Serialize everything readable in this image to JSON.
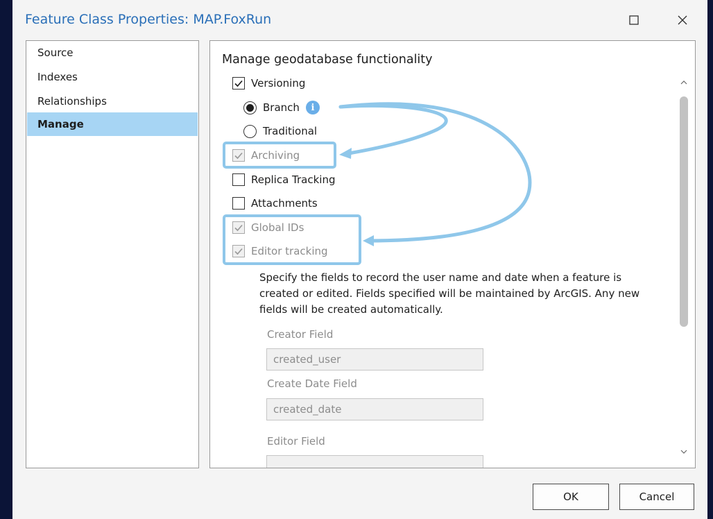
{
  "window": {
    "title": "Feature Class Properties: MAP.FoxRun",
    "maximize_icon": "maximize-icon",
    "close_icon": "close-icon"
  },
  "nav": {
    "items": [
      {
        "label": "Source",
        "active": false
      },
      {
        "label": "Indexes",
        "active": false
      },
      {
        "label": "Relationships",
        "active": false
      },
      {
        "label": "Manage",
        "active": true
      }
    ]
  },
  "manage": {
    "heading": "Manage geodatabase functionality",
    "versioning": {
      "label": "Versioning",
      "checked": true,
      "enabled": true
    },
    "branch": {
      "label": "Branch",
      "selected": true
    },
    "traditional": {
      "label": "Traditional",
      "selected": false
    },
    "archiving": {
      "label": "Archiving",
      "checked": true,
      "enabled": false
    },
    "replica_tracking": {
      "label": "Replica Tracking",
      "checked": false,
      "enabled": true
    },
    "attachments": {
      "label": "Attachments",
      "checked": false,
      "enabled": true
    },
    "global_ids": {
      "label": "Global IDs",
      "checked": true,
      "enabled": false
    },
    "editor_tracking": {
      "label": "Editor tracking",
      "checked": true,
      "enabled": false
    },
    "description": "Specify the fields to record the user name and date when a feature is created or edited. Fields specified will be maintained by ArcGIS. Any new fields will be created automatically.",
    "creator_field": {
      "label": "Creator Field",
      "value": "created_user"
    },
    "create_date_field": {
      "label": "Create Date Field",
      "value": "created_date"
    },
    "editor_field": {
      "label": "Editor Field",
      "value": ""
    }
  },
  "buttons": {
    "ok": "OK",
    "cancel": "Cancel"
  },
  "colors": {
    "title": "#2a6fb8",
    "nav_active": "#a7d5f4",
    "highlight": "#8fc7ea",
    "info_icon": "#6aaee8"
  }
}
